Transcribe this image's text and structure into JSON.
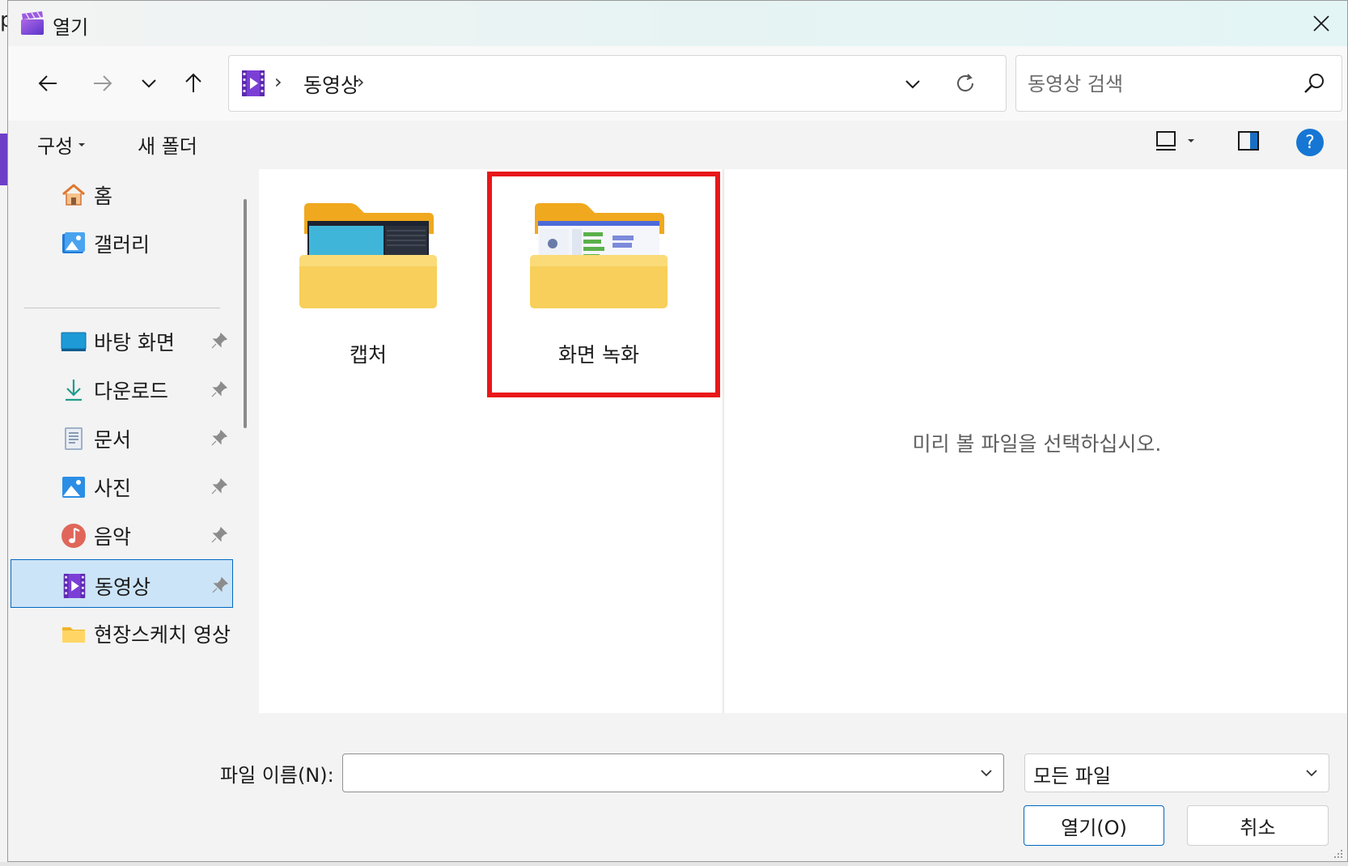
{
  "background": {
    "left_text": "p"
  },
  "window": {
    "title": "열기"
  },
  "nav": {
    "breadcrumb": [
      "동영상"
    ],
    "search_placeholder": "동영상 검색"
  },
  "toolbar": {
    "organize": "구성",
    "new_folder": "새 폴더"
  },
  "sidebar": {
    "items": [
      {
        "label": "홈",
        "icon": "home-icon",
        "pinned": false
      },
      {
        "label": "갤러리",
        "icon": "gallery-icon",
        "pinned": false
      },
      {
        "label": "바탕 화면",
        "icon": "desktop-icon",
        "pinned": true
      },
      {
        "label": "다운로드",
        "icon": "download-icon",
        "pinned": true
      },
      {
        "label": "문서",
        "icon": "document-icon",
        "pinned": true
      },
      {
        "label": "사진",
        "icon": "pictures-icon",
        "pinned": true
      },
      {
        "label": "음악",
        "icon": "music-icon",
        "pinned": true
      },
      {
        "label": "동영상",
        "icon": "videos-icon",
        "pinned": true,
        "selected": true
      },
      {
        "label": "현장스케치 영상",
        "icon": "folder-icon",
        "pinned": false
      }
    ]
  },
  "content": {
    "folders": [
      {
        "name": "캡처",
        "icon": "folder-thumbnail-icon"
      },
      {
        "name": "화면 녹화",
        "icon": "folder-thumbnail-icon",
        "highlighted": true
      }
    ]
  },
  "preview": {
    "message": "미리 볼 파일을 선택하십시오."
  },
  "footer": {
    "filename_label": "파일 이름(N):",
    "filename_value": "",
    "filetype_value": "모든 파일",
    "open_button": "열기(O)",
    "cancel_button": "취소"
  },
  "colors": {
    "accent": "#0067c0",
    "highlight_box": "#e8171a",
    "selected_bg": "#cce4f7",
    "help_blue": "#1676d4"
  }
}
